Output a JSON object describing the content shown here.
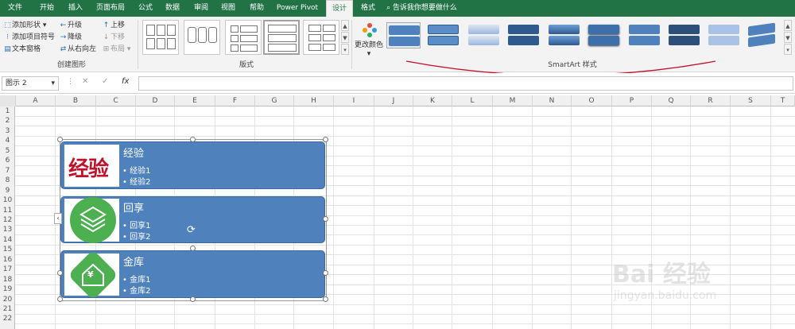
{
  "tabs": [
    "文件",
    "开始",
    "插入",
    "页面布局",
    "公式",
    "数据",
    "审阅",
    "视图",
    "帮助",
    "Power Pivot",
    "设计",
    "格式"
  ],
  "tell_me": "告诉我你想要做什么",
  "create_graphic": {
    "add_shape": "添加形状",
    "add_bullet": "添加项目符号",
    "text_pane": "文本窗格",
    "promote": "升级",
    "demote": "降级",
    "right_to_left": "从右向左",
    "move_up": "上移",
    "move_down": "下移",
    "layout": "布局",
    "group_label": "创建图形"
  },
  "layouts_label": "版式",
  "change_colors": "更改颜色",
  "styles_label": "SmartArt 样式",
  "name_box": "图示 2",
  "fx_label": "fx",
  "columns": [
    "A",
    "B",
    "C",
    "D",
    "E",
    "F",
    "G",
    "H",
    "I",
    "J",
    "K",
    "L",
    "M",
    "N",
    "O",
    "P",
    "Q",
    "R",
    "S",
    "T"
  ],
  "rows": [
    "1",
    "2",
    "3",
    "4",
    "5",
    "6",
    "7",
    "8",
    "9",
    "10",
    "11",
    "12",
    "13",
    "14",
    "15",
    "16",
    "17",
    "18",
    "19",
    "20",
    "21",
    "22"
  ],
  "smartart": [
    {
      "title": "经验",
      "bullets": [
        "经验1",
        "经验2"
      ],
      "icon_text": "经验"
    },
    {
      "title": "回享",
      "bullets": [
        "回享1",
        "回享2"
      ]
    },
    {
      "title": "金库",
      "bullets": [
        "金库1",
        "金库2"
      ],
      "icon_text": "¥"
    }
  ],
  "colors": {
    "ribbon": "#217346",
    "smartart": "#4f81bd",
    "logo_red": "#c0102a",
    "icon_green": "#4caf50"
  },
  "watermark": {
    "logo": "Bai 经验",
    "url": "jingyan.baidu.com"
  }
}
